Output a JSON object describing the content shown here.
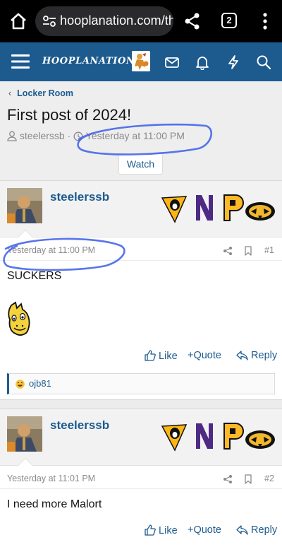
{
  "browser": {
    "url": "hooplanation.com/th",
    "tab_count": "2",
    "icons": [
      "home-icon",
      "site-settings-icon",
      "share-icon",
      "tabs-icon",
      "more-menu-icon"
    ]
  },
  "site": {
    "name": "HOOPLANATION",
    "accent": "#1d5b8f",
    "icons": [
      "hamburger-icon",
      "mail-icon",
      "bell-icon",
      "bolt-icon",
      "search-icon"
    ]
  },
  "thread": {
    "breadcrumb": "Locker Room",
    "title": "First post of 2024!",
    "author": "steelerssb",
    "separator": "·",
    "date": "Yesterday at 11:00 PM",
    "watch_label": "Watch"
  },
  "posts": [
    {
      "author": "steelerssb",
      "time": "Yesterday at 11:00 PM",
      "number": "#1",
      "body": "SUCKERS",
      "reaction_user": "ojb81"
    },
    {
      "author": "steelerssb",
      "time": "Yesterday at 11:01 PM",
      "number": "#2",
      "body": "I need more Malort"
    }
  ],
  "actions": {
    "like": "Like",
    "quote": "Quote",
    "reply": "Reply"
  },
  "annotation_color": "#3b5de7"
}
